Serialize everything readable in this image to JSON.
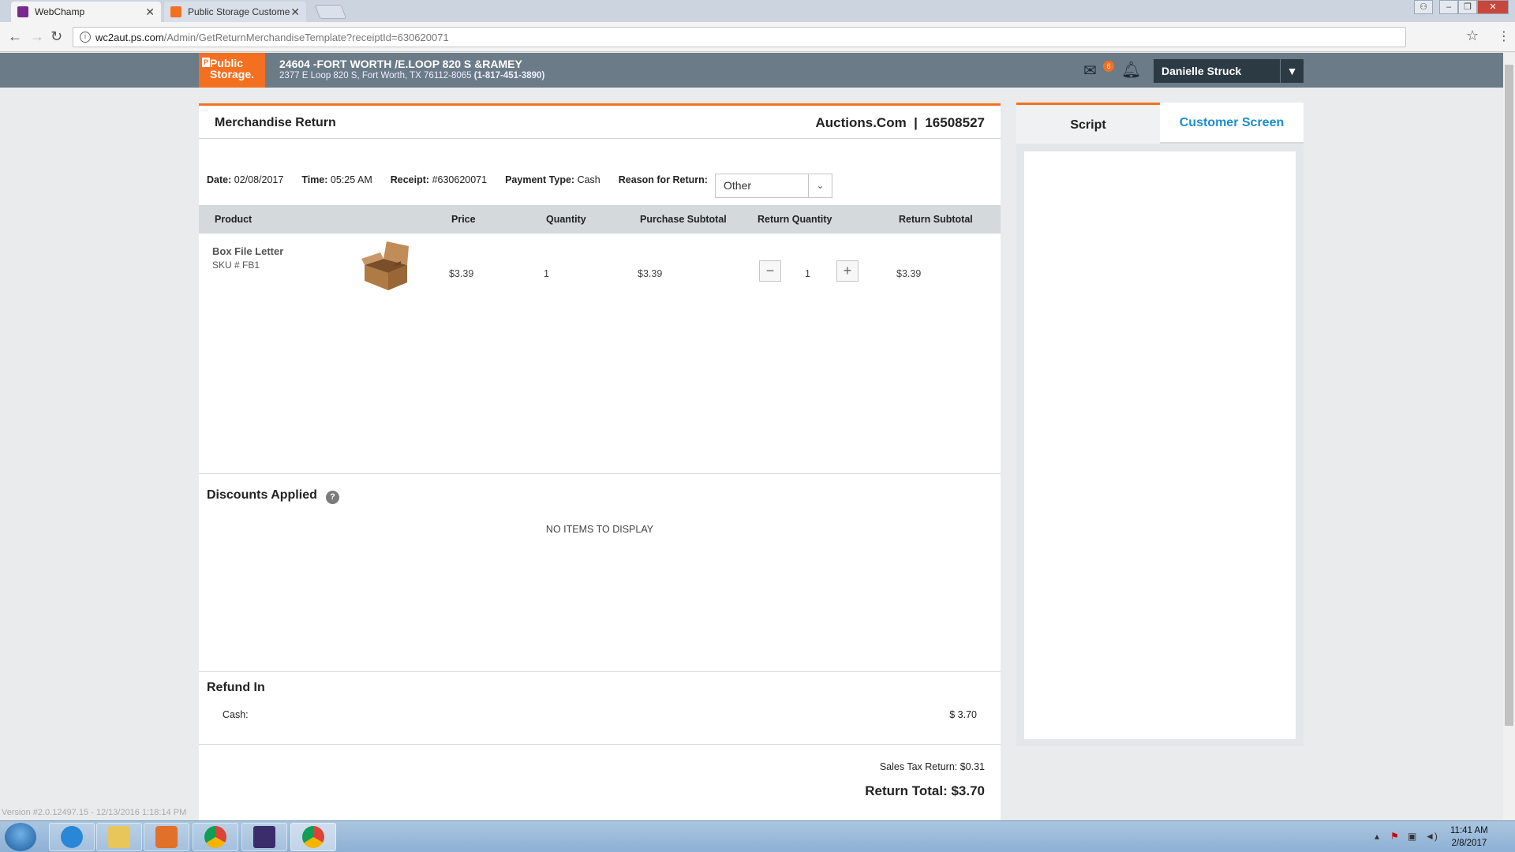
{
  "browser": {
    "tabs": [
      {
        "title": "WebChamp",
        "active": true
      },
      {
        "title": "Public Storage Customer",
        "active": false
      }
    ],
    "url_host": "wc2aut.ps.com",
    "url_path": "/Admin/GetReturnMerchandiseTemplate?receiptId=630620071"
  },
  "header": {
    "logo_line1": "Public",
    "logo_line2": "Storage.",
    "facility_name": "24604 -FORT WORTH /E.LOOP 820 S &RAMEY",
    "facility_address": "2377 E Loop 820 S, Fort Worth, TX 76112-8065",
    "facility_phone": "(1-817-451-3890)",
    "mail_count": "6",
    "user_name": "Danielle Struck"
  },
  "panel": {
    "title": "Merchandise Return",
    "account": "Auctions.Com  |  16508527"
  },
  "meta": {
    "date_label": "Date:",
    "date": "02/08/2017",
    "time_label": "Time:",
    "time": "05:25 AM",
    "receipt_label": "Receipt:",
    "receipt": "#630620071",
    "payment_label": "Payment Type:",
    "payment": "Cash",
    "reason_label": "Reason for Return:",
    "reason_value": "Other"
  },
  "table": {
    "headers": [
      "Product",
      "Price",
      "Quantity",
      "Purchase Subtotal",
      "Return Quantity",
      "Return Subtotal"
    ],
    "rows": [
      {
        "name": "Box File Letter",
        "sku": "SKU # FB1",
        "price": "$3.39",
        "quantity": "1",
        "purchase_subtotal": "$3.39",
        "return_quantity": "1",
        "return_subtotal": "$3.39"
      }
    ]
  },
  "discounts": {
    "title": "Discounts Applied",
    "empty_text": "NO ITEMS TO DISPLAY"
  },
  "refund": {
    "title": "Refund In",
    "method_label": "Cash:",
    "amount": "$ 3.70",
    "tax_line": "Sales Tax Return: $0.31",
    "total_line": "Return Total: $3.70"
  },
  "right_panel": {
    "tab_script": "Script",
    "tab_customer": "Customer Screen"
  },
  "footer": {
    "version": "Version #2.0.12497.15 - 12/13/2016 1:18:14 PM"
  },
  "taskbar": {
    "time": "11:41 AM",
    "date": "2/8/2017"
  },
  "colors": {
    "brand_orange": "#f37021",
    "header_gray": "#6b7b87",
    "link_blue": "#1c8dcf"
  }
}
